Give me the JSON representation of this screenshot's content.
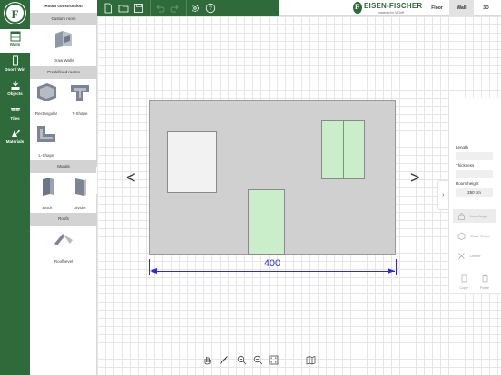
{
  "nav": {
    "items": [
      {
        "label": "Walls",
        "icon": "walls-icon",
        "active": true
      },
      {
        "label": "Door / Win",
        "icon": "door-window-icon",
        "active": false
      },
      {
        "label": "Objects",
        "icon": "objects-icon",
        "active": false
      },
      {
        "label": "Tiles",
        "icon": "tiles-icon",
        "active": false
      },
      {
        "label": "Materials",
        "icon": "materials-icon",
        "active": false
      }
    ]
  },
  "panel": {
    "title": "Room construction",
    "sections": {
      "custom": "Custom room",
      "predefined": "Predefined rooms",
      "murals": "Murals",
      "roofs": "Roofs"
    },
    "items": {
      "draw_walls": "Draw Walls",
      "rectangular": "Rectangular",
      "t_shape": "T-Shape",
      "l_shape": "L-Shape",
      "block": "Block",
      "divider": "Divider",
      "roof_bevel": "Roofbevel"
    }
  },
  "brand": {
    "name": "EISEN-FISCHER",
    "sub": "powered by VIGeft"
  },
  "view_tabs": [
    {
      "label": "Floor",
      "active": false
    },
    {
      "label": "Wall",
      "active": true
    },
    {
      "label": "3D",
      "active": false
    }
  ],
  "canvas": {
    "dimension": "400"
  },
  "properties": {
    "length_label": "Length",
    "length_value": "",
    "thickness_label": "Thickness",
    "thickness_value": "",
    "room_height_label": "Room height",
    "room_height_value": "250 cm",
    "lock_angle": "Lock Angle",
    "close_room": "Close Room",
    "delete": "Delete",
    "copy": "Copy",
    "paste": "Paste"
  },
  "colors": {
    "brand_green": "#2f6b3a",
    "opening_green": "#c9eec9",
    "dimension_blue": "#2b2bd9",
    "wall_grey": "#d0d0d0"
  }
}
